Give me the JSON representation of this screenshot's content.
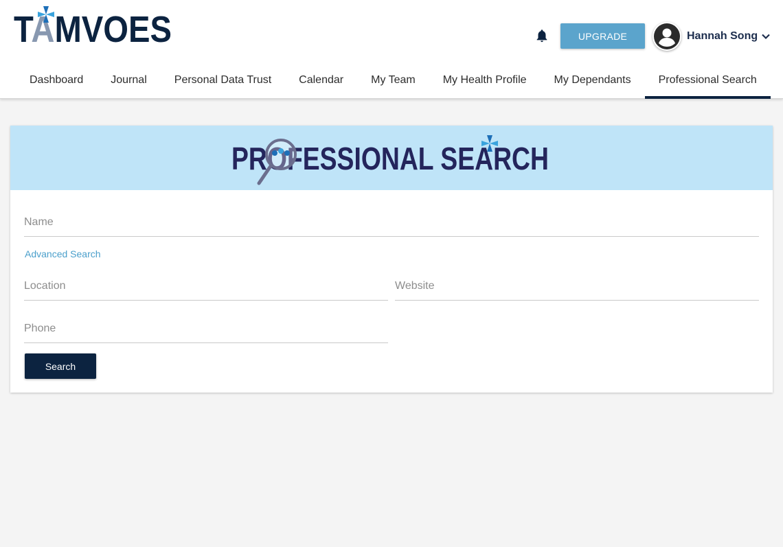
{
  "brand": {
    "logo_text": "TAMVOES",
    "colors": {
      "navy": "#0c2340",
      "accent": "#5ba4cc",
      "banner": "#bfe4f8"
    }
  },
  "header": {
    "notification_icon": "bell-icon",
    "upgrade_label": "UPGRADE",
    "user": {
      "name": "Hannah Song",
      "avatar_icon": "user-avatar-icon",
      "menu_icon": "chevron-down-icon"
    }
  },
  "nav": {
    "items": [
      {
        "label": "Dashboard"
      },
      {
        "label": "Journal"
      },
      {
        "label": "Personal Data Trust"
      },
      {
        "label": "Calendar"
      },
      {
        "label": "My Team"
      },
      {
        "label": "My Health Profile"
      },
      {
        "label": "My Dependants"
      },
      {
        "label": "Professional Search"
      }
    ],
    "active": "Professional Search"
  },
  "search": {
    "banner_title": "PROFESSIONAL SEARCH",
    "name_placeholder": "Name",
    "advanced_link": "Advanced Search",
    "location_placeholder": "Location",
    "website_placeholder": "Website",
    "phone_placeholder": "Phone",
    "search_label": "Search"
  }
}
